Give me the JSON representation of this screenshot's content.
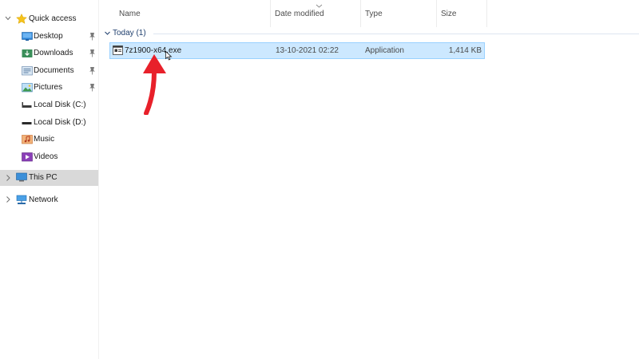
{
  "nav": {
    "quick_access": "Quick access",
    "items": [
      {
        "label": "Desktop",
        "icon": "desktop-folder-icon",
        "pinned": true
      },
      {
        "label": "Downloads",
        "icon": "downloads-folder-icon",
        "pinned": true
      },
      {
        "label": "Documents",
        "icon": "documents-folder-icon",
        "pinned": true
      },
      {
        "label": "Pictures",
        "icon": "pictures-folder-icon",
        "pinned": true
      },
      {
        "label": "Local Disk (C:)",
        "icon": "drive-icon",
        "pinned": false
      },
      {
        "label": "Local Disk (D:)",
        "icon": "drive-icon",
        "pinned": false
      },
      {
        "label": "Music",
        "icon": "music-folder-icon",
        "pinned": false
      },
      {
        "label": "Videos",
        "icon": "videos-folder-icon",
        "pinned": false
      }
    ],
    "this_pc": "This PC",
    "network": "Network"
  },
  "columns": {
    "name": "Name",
    "date_modified": "Date modified",
    "type": "Type",
    "size": "Size"
  },
  "group": {
    "label": "Today (1)"
  },
  "files": [
    {
      "name": "7z1900-x64.exe",
      "date_modified": "13-10-2021 02:22",
      "type": "Application",
      "size": "1,414 KB"
    }
  ],
  "colors": {
    "selection_fill": "#cce8ff",
    "selection_border": "#99d1ff",
    "nav_selected": "#d9d9d9",
    "annotation_arrow": "#e8202a"
  }
}
